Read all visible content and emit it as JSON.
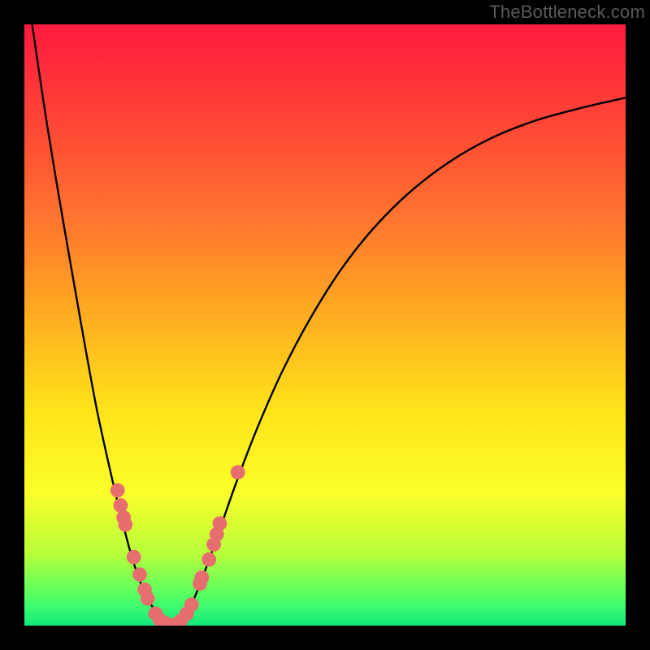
{
  "watermark": "TheBottleneck.com",
  "gradient": {
    "stops": [
      {
        "pos": 0.0,
        "color": "#ff1a3e"
      },
      {
        "pos": 0.18,
        "color": "#ff4a35"
      },
      {
        "pos": 0.34,
        "color": "#ff7a2e"
      },
      {
        "pos": 0.5,
        "color": "#ffb21f"
      },
      {
        "pos": 0.64,
        "color": "#ffe31a"
      },
      {
        "pos": 0.78,
        "color": "#faff2a"
      },
      {
        "pos": 0.88,
        "color": "#b8ff3a"
      },
      {
        "pos": 0.96,
        "color": "#47ff6a"
      },
      {
        "pos": 1.0,
        "color": "#12e97c"
      }
    ]
  },
  "chart_data": {
    "type": "line",
    "title": "",
    "xlabel": "",
    "ylabel": "",
    "xlim": [
      0,
      1
    ],
    "ylim": [
      0,
      1
    ],
    "note": "V-shaped bottleneck curve. x is normalized component scale; y is bottleneck severity (1=top/red, 0=bottom/green). Minimum (optimal match) around x≈0.24.",
    "series": [
      {
        "name": "bottleneck-curve",
        "color": "#000000",
        "x": [
          0.013,
          0.032,
          0.053,
          0.078,
          0.1,
          0.12,
          0.14,
          0.16,
          0.18,
          0.2,
          0.215,
          0.225,
          0.235,
          0.245,
          0.255,
          0.265,
          0.28,
          0.3,
          0.325,
          0.355,
          0.39,
          0.43,
          0.475,
          0.525,
          0.58,
          0.64,
          0.705,
          0.775,
          0.85,
          0.93,
          1.0
        ],
        "y": [
          1.0,
          0.87,
          0.74,
          0.595,
          0.47,
          0.362,
          0.27,
          0.185,
          0.11,
          0.055,
          0.028,
          0.012,
          0.004,
          0.0,
          0.004,
          0.014,
          0.04,
          0.09,
          0.16,
          0.245,
          0.335,
          0.425,
          0.51,
          0.59,
          0.66,
          0.72,
          0.77,
          0.81,
          0.84,
          0.862,
          0.878
        ]
      }
    ],
    "points": {
      "name": "sample-dots",
      "color": "#e76e6e",
      "radius_norm": 0.012,
      "xy": [
        [
          0.155,
          0.225
        ],
        [
          0.16,
          0.2
        ],
        [
          0.165,
          0.18
        ],
        [
          0.168,
          0.168
        ],
        [
          0.182,
          0.114
        ],
        [
          0.192,
          0.085
        ],
        [
          0.2,
          0.06
        ],
        [
          0.205,
          0.045
        ],
        [
          0.218,
          0.02
        ],
        [
          0.225,
          0.01
        ],
        [
          0.235,
          0.004
        ],
        [
          0.243,
          0.0
        ],
        [
          0.25,
          0.0
        ],
        [
          0.255,
          0.003
        ],
        [
          0.26,
          0.008
        ],
        [
          0.27,
          0.02
        ],
        [
          0.278,
          0.035
        ],
        [
          0.292,
          0.07
        ],
        [
          0.295,
          0.08
        ],
        [
          0.307,
          0.11
        ],
        [
          0.315,
          0.135
        ],
        [
          0.32,
          0.152
        ],
        [
          0.325,
          0.17
        ],
        [
          0.355,
          0.255
        ]
      ]
    }
  }
}
